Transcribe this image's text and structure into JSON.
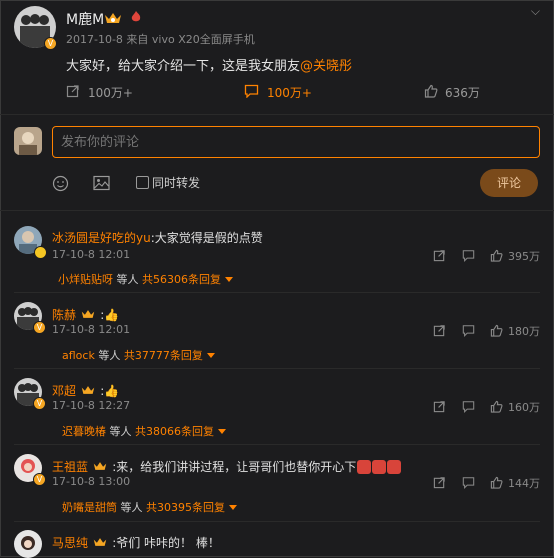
{
  "post": {
    "author": "M鹿M",
    "meta": "2017-10-8 来自 vivo X20全面屏手机",
    "text_prefix": "大家好，给大家介绍一下，这是我女朋友",
    "mention": "@关晓彤",
    "reposts": "100万+",
    "comments": "100万+",
    "likes": "636万"
  },
  "compose": {
    "placeholder": "发布你的评论",
    "also_repost": "同时转发",
    "submit": "评论"
  },
  "comments": [
    {
      "name": "冰汤圆是好吃的yu",
      "text": ":大家觉得是假的点赞",
      "time": "17-10-8 12:01",
      "likes": "395万",
      "reply_user": "小烊贴贴呀",
      "reply_mid": " 等人 ",
      "reply_total": "共56306条回复"
    },
    {
      "name": "陈赫",
      "text": ":👍",
      "time": "17-10-8 12:01",
      "likes": "180万",
      "reply_user": "aflock",
      "reply_mid": " 等人 ",
      "reply_total": "共37777条回复"
    },
    {
      "name": "邓超",
      "text": ":👍",
      "time": "17-10-8 12:27",
      "likes": "160万",
      "reply_user": "迟暮晚椿",
      "reply_mid": " 等人 ",
      "reply_total": "共38066条回复"
    },
    {
      "name": "王祖蓝",
      "text": ":来，给我们讲讲过程，让哥哥们也替你开心下",
      "time": "17-10-8 13:00",
      "likes": "144万",
      "reply_user": "奶嘴是甜筒",
      "reply_mid": " 等人 ",
      "reply_total": "共30395条回复"
    },
    {
      "name": "马思纯",
      "text": ":爷们 咔咔的！ 棒！"
    }
  ],
  "colors": {
    "accent": "#ff8200",
    "bg": "#1c1c1e"
  },
  "icons": [
    "chevron-down-icon",
    "crown-badge-icon",
    "verified-badge-icon",
    "repost-icon",
    "comment-icon",
    "like-icon",
    "emoji-icon",
    "image-icon",
    "checkbox-icon"
  ]
}
